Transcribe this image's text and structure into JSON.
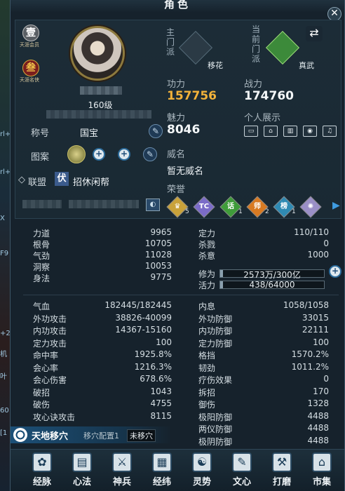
{
  "window": {
    "title": "角色",
    "close_glyph": "✕"
  },
  "left_strip_fragments": [
    "rl+",
    "rl+",
    "X",
    "F9",
    "+2",
    "机",
    "叶",
    "60",
    "[1"
  ],
  "profile": {
    "badge_one": {
      "glyph": "壹",
      "caption": "天涯会员"
    },
    "badge_three": {
      "glyph": "叁",
      "caption": "天涯名侠"
    },
    "level": "160级",
    "title_label": "称号",
    "title_value": "国宝",
    "pattern_label": "图案",
    "guild_label": "联盟",
    "guild_tag": "伏",
    "guild_name": "招休闲帮"
  },
  "sect": {
    "main_label": "主门派",
    "main_name": "移花",
    "current_label": "当前门派",
    "current_name": "真武",
    "swap_glyph": "⇄"
  },
  "power": {
    "gongli_label": "功力",
    "gongli_value": "157756",
    "zhanli_label": "战力",
    "zhanli_value": "174760",
    "meili_label": "魅力",
    "meili_value": "8046",
    "show_label": "个人展示",
    "show_icons": [
      "name-card-icon",
      "house-icon",
      "city-icon",
      "eye-icon",
      "bell-icon"
    ]
  },
  "fame": {
    "label": "威名",
    "value": "暂无威名"
  },
  "honor": {
    "label": "荣誉",
    "badges": [
      {
        "name": "crown-badge-icon",
        "glyph": "♛",
        "count": "5",
        "color": "#c9a23a"
      },
      {
        "name": "tc-badge-icon",
        "glyph": "TC",
        "count": "",
        "color": "#7b6cc8"
      },
      {
        "name": "hua-badge-icon",
        "glyph": "话",
        "count": "1",
        "color": "#3f9c3a"
      },
      {
        "name": "shi-badge-icon",
        "glyph": "师",
        "count": "2",
        "color": "#d87a22"
      },
      {
        "name": "bang-badge-icon",
        "glyph": "榜",
        "count": "1",
        "color": "#2f8ab3"
      },
      {
        "name": "swirl-badge-icon",
        "glyph": "✺",
        "count": "",
        "color": "#9a8fc7"
      }
    ],
    "next_glyph": "▶"
  },
  "attributes": {
    "left": [
      {
        "label": "力道",
        "value": "9965"
      },
      {
        "label": "根骨",
        "value": "10705"
      },
      {
        "label": "气劲",
        "value": "11028"
      },
      {
        "label": "洞察",
        "value": "10053"
      },
      {
        "label": "身法",
        "value": "9775"
      }
    ],
    "right": [
      {
        "label": "定力",
        "value": "110/110"
      },
      {
        "label": "杀戮",
        "value": "0"
      },
      {
        "label": "杀意",
        "value": "1000"
      }
    ],
    "xiuwei": {
      "label": "修为",
      "value": "2573万/300亿",
      "fill": 0.009
    },
    "huoli": {
      "label": "活力",
      "value": "438/64000",
      "fill": 0.007
    }
  },
  "combat": {
    "left": [
      {
        "label": "气血",
        "value": "182445/182445"
      },
      {
        "label": "外功攻击",
        "value": "38826-40099"
      },
      {
        "label": "内功攻击",
        "value": "14367-15160"
      },
      {
        "label": "定力攻击",
        "value": "100"
      },
      {
        "label": "命中率",
        "value": "1925.8%"
      },
      {
        "label": "会心率",
        "value": "1216.3%"
      },
      {
        "label": "会心伤害",
        "value": "678.6%"
      },
      {
        "label": "破招",
        "value": "1043"
      },
      {
        "label": "破伤",
        "value": "4755"
      },
      {
        "label": "攻心诀攻击",
        "value": "8115"
      }
    ],
    "right": [
      {
        "label": "内息",
        "value": "1058/1058"
      },
      {
        "label": "外功防御",
        "value": "33015"
      },
      {
        "label": "内功防御",
        "value": "22111"
      },
      {
        "label": "定力防御",
        "value": "100"
      },
      {
        "label": "格挡",
        "value": "1570.2%"
      },
      {
        "label": "韧劲",
        "value": "1011.2%"
      },
      {
        "label": "疗伤效果",
        "value": "0"
      },
      {
        "label": "拆招",
        "value": "170"
      },
      {
        "label": "御伤",
        "value": "1328"
      },
      {
        "label": "极阳防御",
        "value": "4488"
      },
      {
        "label": "两仪防御",
        "value": "4488"
      },
      {
        "label": "极阴防御",
        "value": "4488"
      }
    ]
  },
  "acupoint": {
    "title": "天地移穴",
    "config": "移穴配置1",
    "status": "未移穴"
  },
  "bottom_nav": [
    {
      "id": "jingmai",
      "label": "经脉",
      "icon": "meridian-icon",
      "glyph": "✿"
    },
    {
      "id": "xinfa",
      "label": "心法",
      "icon": "book-icon",
      "glyph": "▤"
    },
    {
      "id": "shenbing",
      "label": "神兵",
      "icon": "weapon-icon",
      "glyph": "⚔"
    },
    {
      "id": "jingwei",
      "label": "经纬",
      "icon": "grid-icon",
      "glyph": "▦"
    },
    {
      "id": "lingshi",
      "label": "灵势",
      "icon": "spirit-icon",
      "glyph": "☯"
    },
    {
      "id": "wenxin",
      "label": "文心",
      "icon": "brush-icon",
      "glyph": "✎"
    },
    {
      "id": "damo",
      "label": "打磨",
      "icon": "hammer-icon",
      "glyph": "⚒"
    },
    {
      "id": "shiji",
      "label": "市集",
      "icon": "market-icon",
      "glyph": "⌂"
    }
  ]
}
